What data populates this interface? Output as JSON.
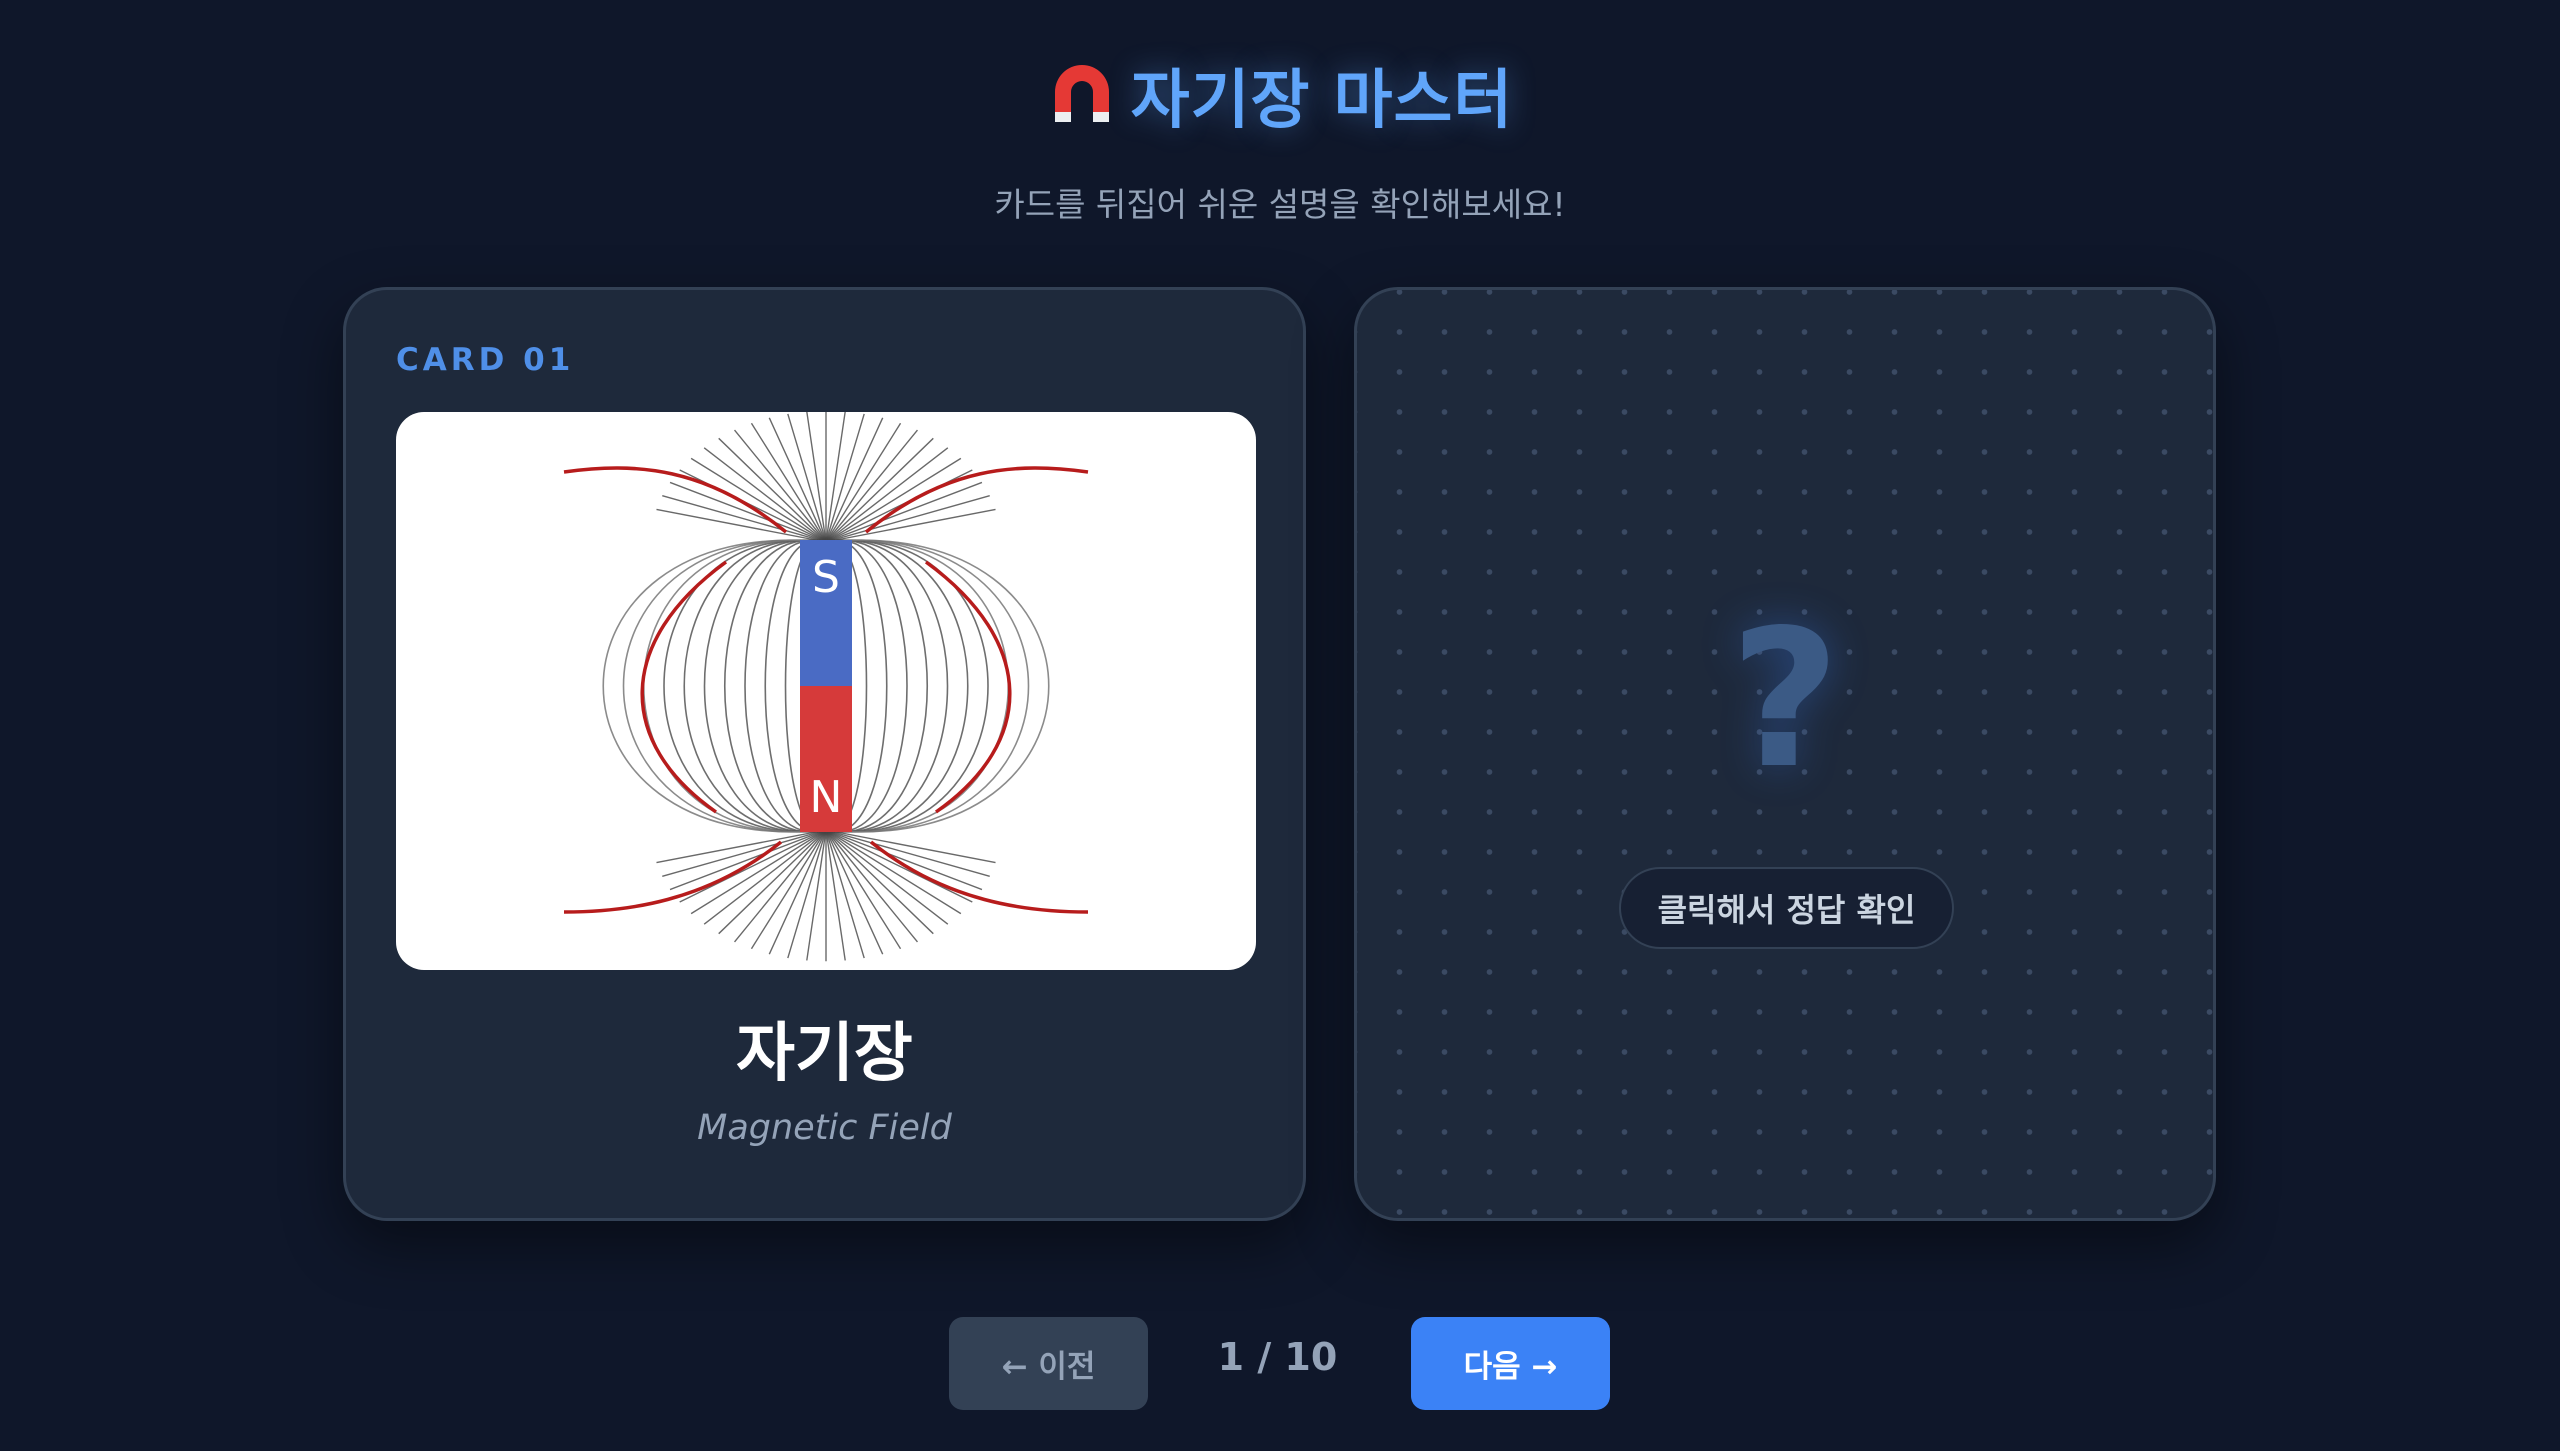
{
  "header": {
    "title": "자기장 마스터",
    "subtitle": "카드를 뒤집어 쉬운 설명을 확인해보세요!"
  },
  "card": {
    "label": "CARD 01",
    "term": "자기장",
    "term_en": "Magnetic Field",
    "magnet": {
      "top_pole": "S",
      "bottom_pole": "N"
    }
  },
  "back": {
    "question": "?",
    "reveal_label": "클릭해서 정답 확인"
  },
  "nav": {
    "prev_label": "← 이전",
    "counter": "1 / 10",
    "next_label": "다음 →"
  },
  "colors": {
    "background": "#0f172a",
    "accent": "#60a5fa",
    "next_button": "#3b82f6",
    "magnet_south": "#4a6bc4",
    "magnet_north": "#d63a3a"
  },
  "icons": [
    "magnet-icon",
    "question-mark-icon",
    "arrow-left-icon",
    "arrow-right-icon"
  ]
}
